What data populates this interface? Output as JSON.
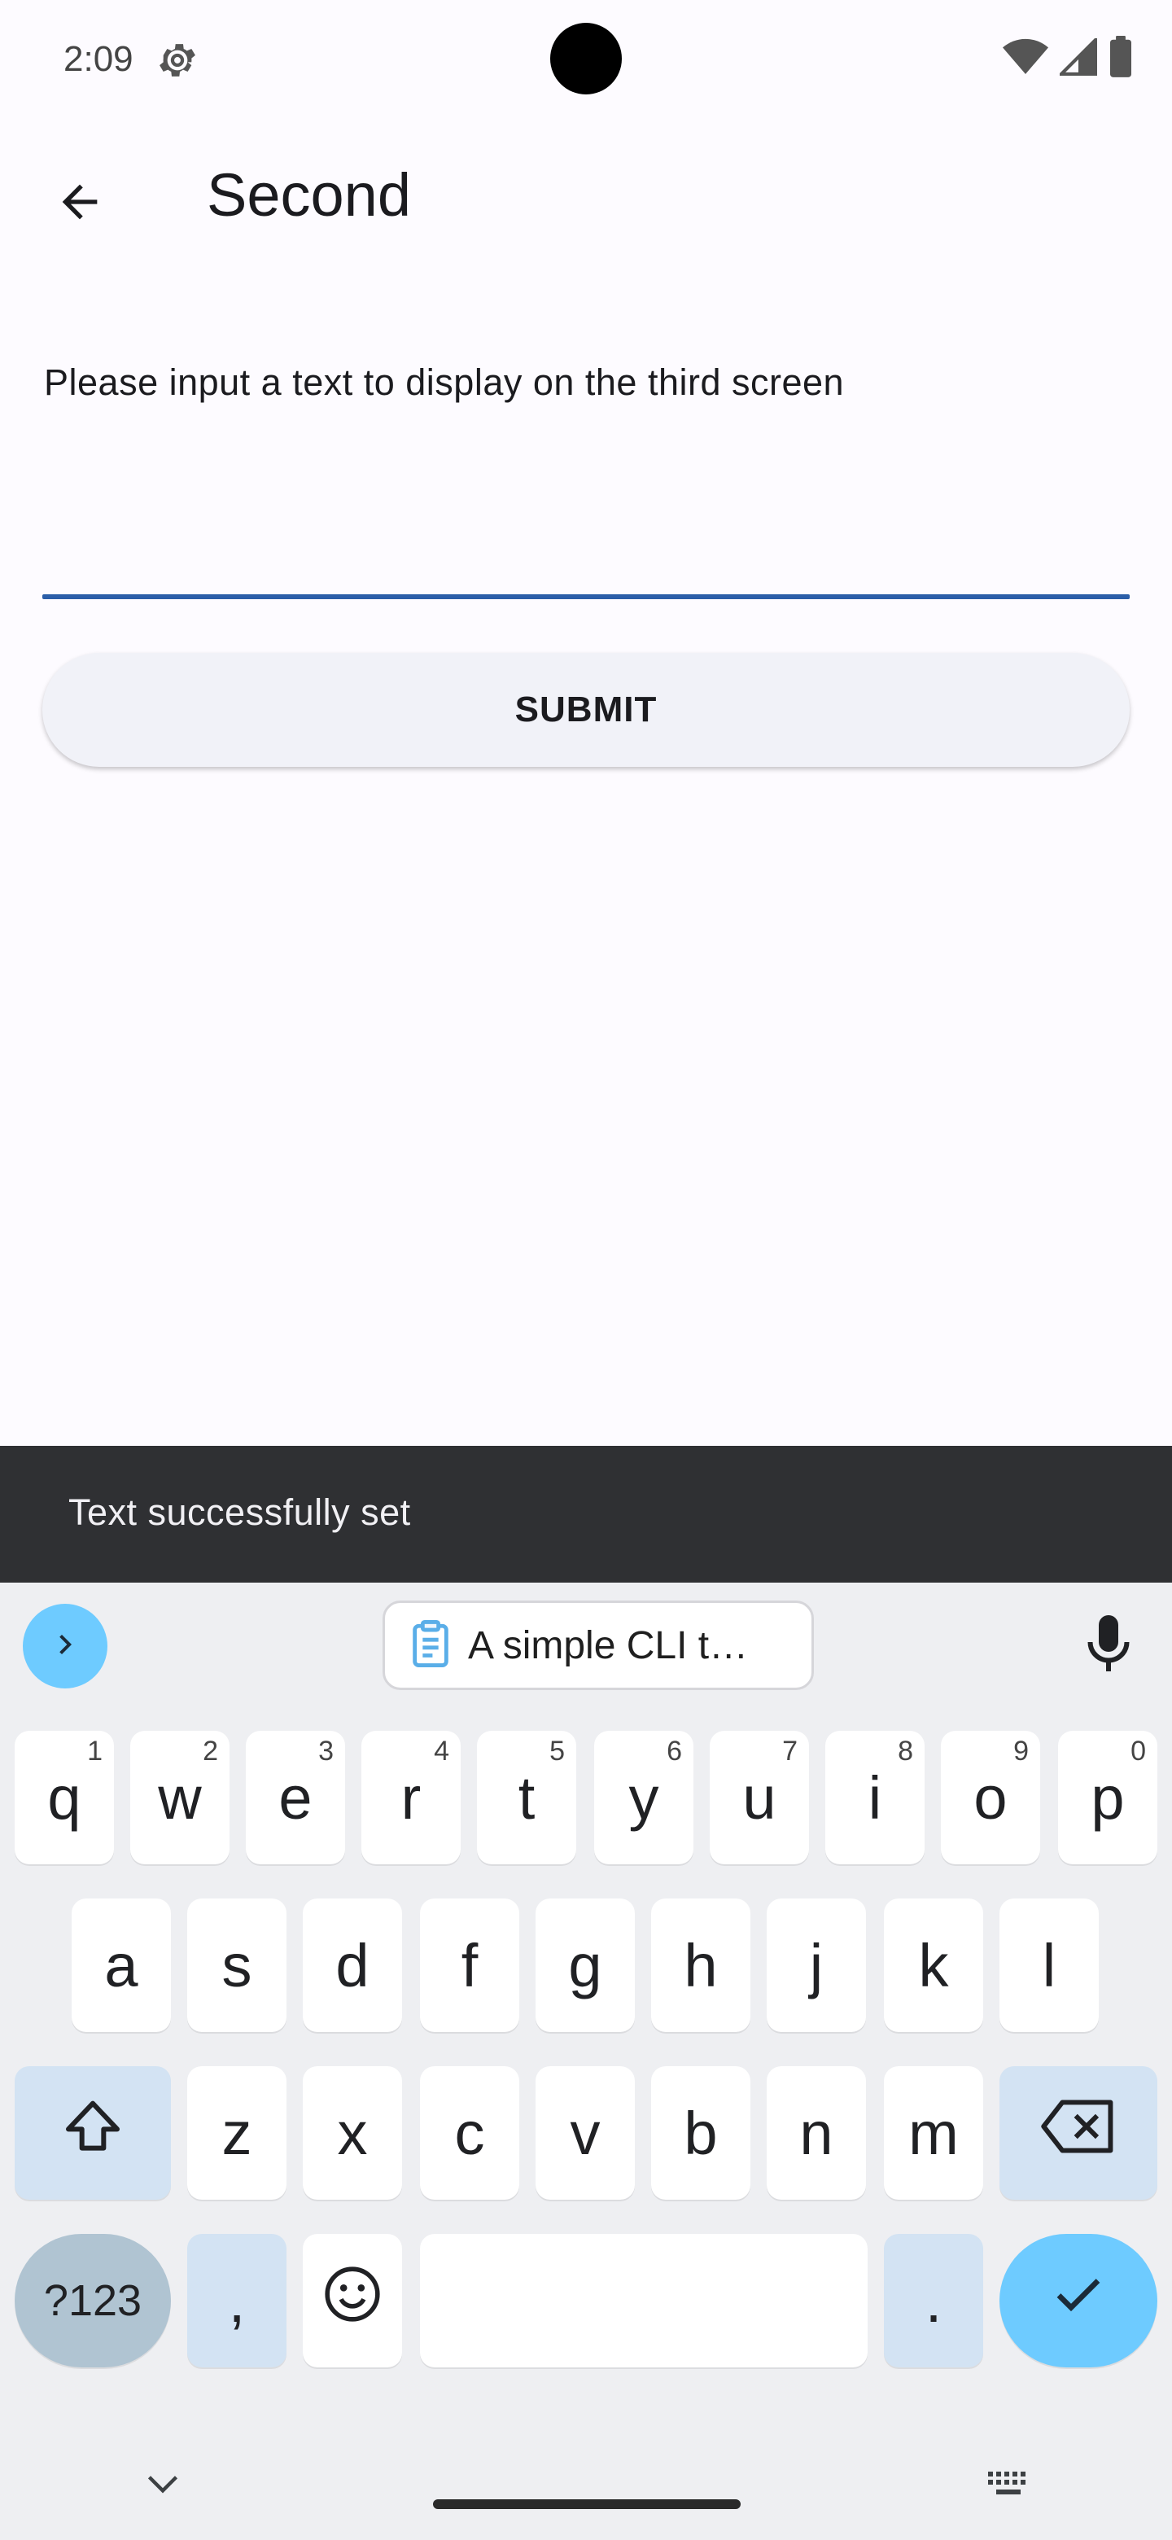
{
  "status_bar": {
    "time": "2:09",
    "icons": [
      "gear-icon",
      "wifi-icon",
      "cellular-signal-icon",
      "battery-icon"
    ]
  },
  "app_bar": {
    "back_icon": "arrow-back-icon",
    "title": "Second"
  },
  "form": {
    "label": "Please input a text to display on the third screen",
    "value": "",
    "submit_label": "SUBMIT",
    "underline_color": "#2b5ea8"
  },
  "snackbar": {
    "message": "Text successfully set"
  },
  "keyboard": {
    "suggestion": "A simple CLI t…",
    "row1": [
      {
        "label": "q",
        "hint": "1"
      },
      {
        "label": "w",
        "hint": "2"
      },
      {
        "label": "e",
        "hint": "3"
      },
      {
        "label": "r",
        "hint": "4"
      },
      {
        "label": "t",
        "hint": "5"
      },
      {
        "label": "y",
        "hint": "6"
      },
      {
        "label": "u",
        "hint": "7"
      },
      {
        "label": "i",
        "hint": "8"
      },
      {
        "label": "o",
        "hint": "9"
      },
      {
        "label": "p",
        "hint": "0"
      }
    ],
    "row2": [
      "a",
      "s",
      "d",
      "f",
      "g",
      "h",
      "j",
      "k",
      "l"
    ],
    "row3": [
      "z",
      "x",
      "c",
      "v",
      "b",
      "n",
      "m"
    ],
    "symbols_label": "?123",
    "comma_label": ",",
    "period_label": ".",
    "accent_color": "#6ecbff"
  }
}
